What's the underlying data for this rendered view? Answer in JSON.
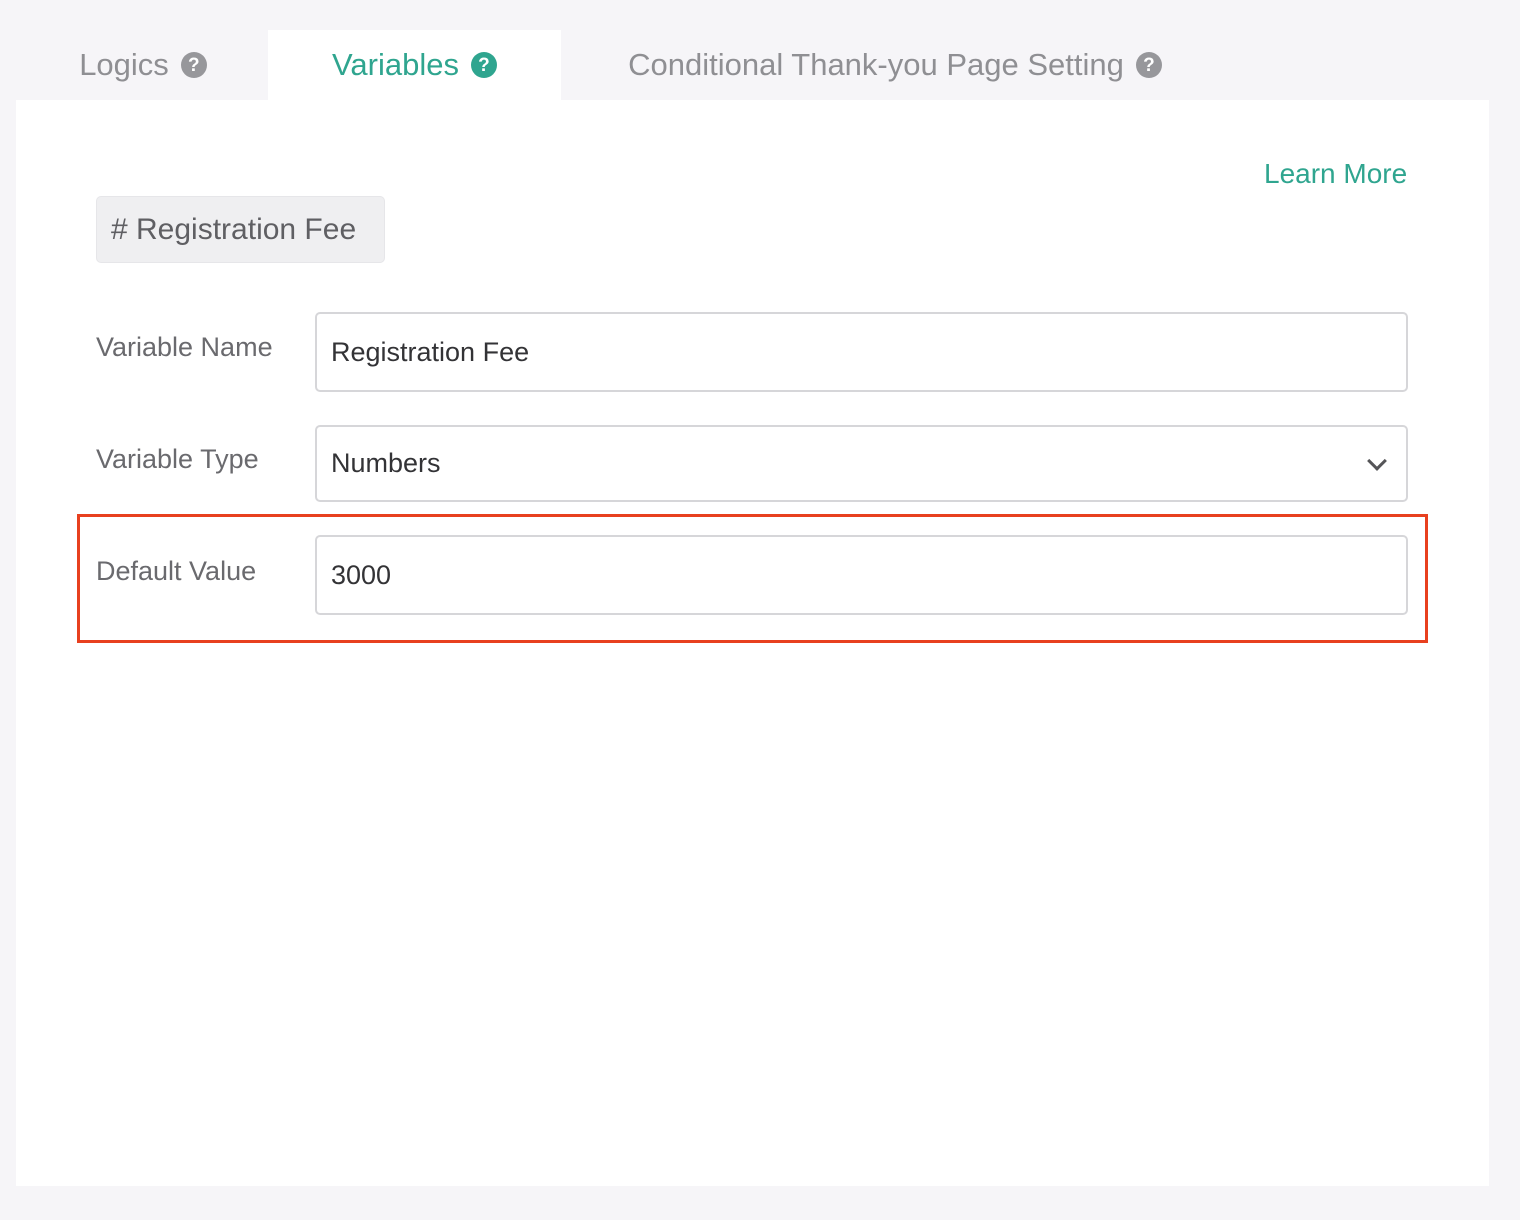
{
  "tabs": [
    {
      "label": "Logics",
      "active": false
    },
    {
      "label": "Variables",
      "active": true
    },
    {
      "label": "Conditional Thank-you Page Setting",
      "active": false
    }
  ],
  "help_icon_glyph": "?",
  "panel": {
    "learn_more": "Learn More",
    "variable_chip": "# Registration Fee",
    "fields": {
      "variable_name": {
        "label": "Variable Name",
        "value": "Registration Fee"
      },
      "variable_type": {
        "label": "Variable Type",
        "value": "Numbers"
      },
      "default_value": {
        "label": "Default Value",
        "value": "3000"
      }
    }
  },
  "colors": {
    "accent": "#2fa58f",
    "highlight": "#e8401f",
    "background": "#f6f5f8"
  }
}
